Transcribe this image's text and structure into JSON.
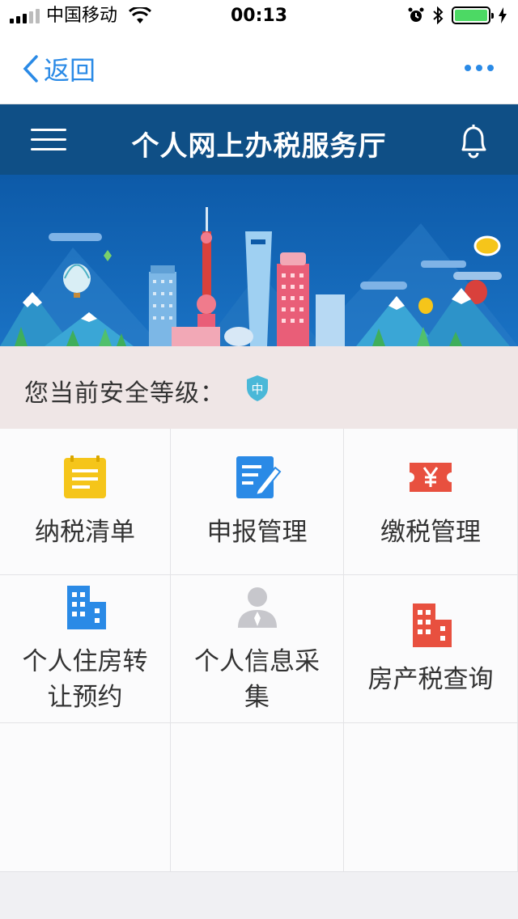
{
  "status_bar": {
    "carrier": "中国移动",
    "time": "00:13"
  },
  "nav": {
    "back_label": "返回"
  },
  "header": {
    "title": "个人网上办税服务厅"
  },
  "security": {
    "label": "您当前安全等级：",
    "level": "中"
  },
  "grid_items": [
    {
      "label": "纳税清单",
      "icon": "list-icon",
      "color": "#f5c51a"
    },
    {
      "label": "申报管理",
      "icon": "edit-document-icon",
      "color": "#2a8ae6"
    },
    {
      "label": "缴税管理",
      "icon": "yuan-ticket-icon",
      "color": "#e8503f"
    },
    {
      "label": "个人住房转让预约",
      "icon": "building-icon",
      "color": "#2a8ae6"
    },
    {
      "label": "个人信息采集",
      "icon": "person-icon",
      "color": "#c7c7cc"
    },
    {
      "label": "房产税查询",
      "icon": "red-building-icon",
      "color": "#e8503f"
    }
  ],
  "colors": {
    "accent": "#2a8ae6",
    "header_bg": "#0f4f86",
    "security_bg": "#efe6e6"
  }
}
